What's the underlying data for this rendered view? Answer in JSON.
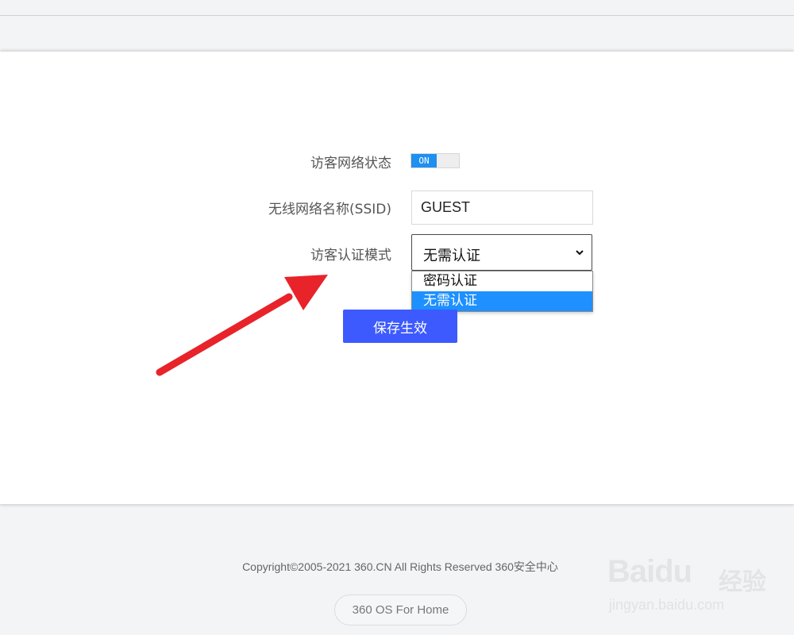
{
  "form": {
    "guest_status_label": "访客网络状态",
    "guest_status_toggle": "ON",
    "ssid_label": "无线网络名称(SSID)",
    "ssid_value": "GUEST",
    "auth_mode_label": "访客认证模式",
    "auth_mode_selected": "无需认证",
    "auth_mode_options": [
      "密码认证",
      "无需认证"
    ],
    "save_label": "保存生效"
  },
  "footer": {
    "copyright": "Copyright©2005-2021 360.CN All Rights Reserved 360安全中心",
    "os_label": "360 OS For Home"
  },
  "watermark": {
    "brand": "Baidu",
    "sub": "经验",
    "url": "jingyan.baidu.com"
  },
  "colors": {
    "accent_blue": "#3d5afe",
    "toggle_blue": "#1f8ff0",
    "selected_option": "#1e90ff",
    "arrow_red": "#e8232a"
  }
}
